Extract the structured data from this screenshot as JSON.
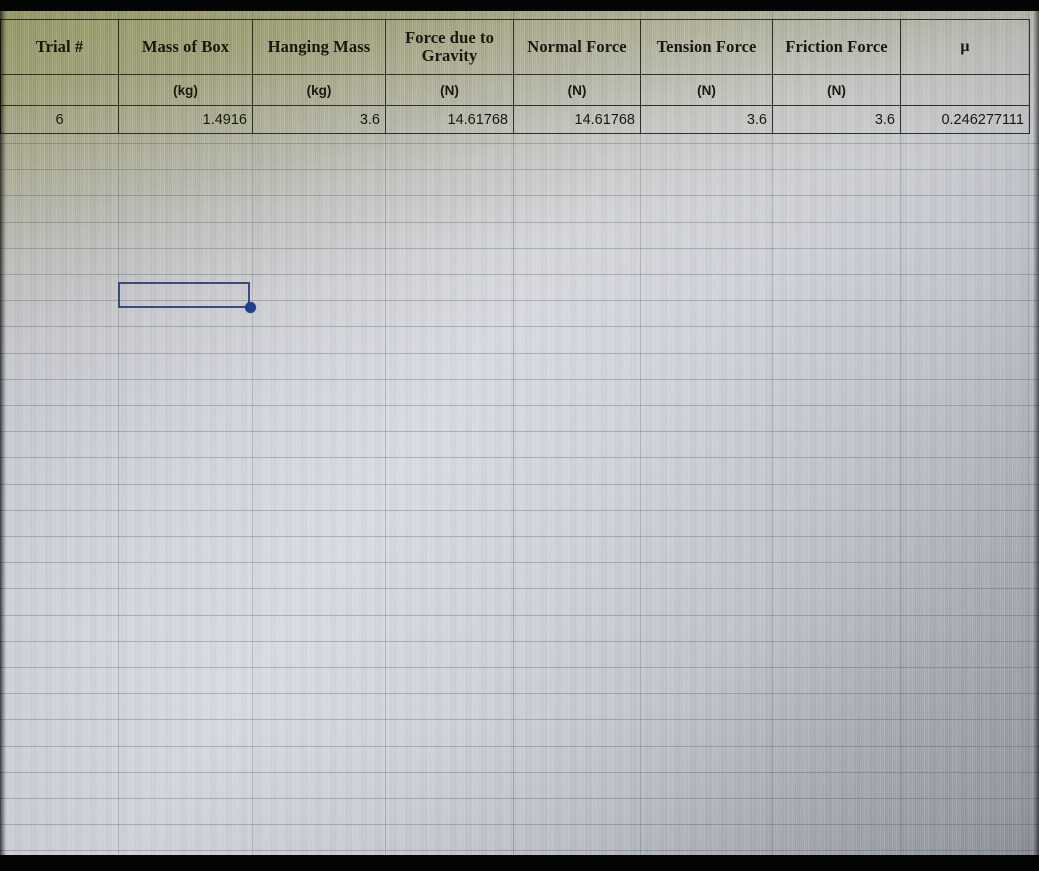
{
  "app": {
    "type": "spreadsheet",
    "capture": "photo-of-screen"
  },
  "colors": {
    "selection_border": "#3c4a7d",
    "fill_handle": "#1f3f8f",
    "table_border": "#2d3026",
    "text": "#17180f",
    "screen_tint_top": "#96986 2",
    "screen_body": "#d2d5dc"
  },
  "table": {
    "headers": [
      "Trial #",
      "Mass of Box",
      "Hanging Mass",
      "Force due to Gravity",
      "Normal Force",
      "Tension Force",
      "Friction Force",
      "μ"
    ],
    "units": [
      "",
      "(kg)",
      "(kg)",
      "(N)",
      "(N)",
      "(N)",
      "(N)",
      ""
    ],
    "rows": [
      {
        "trial": "6",
        "mass_of_box": "1.4916",
        "hanging_mass": "3.6",
        "force_due_to_gravity": "14.61768",
        "normal_force": "14.61768",
        "tension_force": "3.6",
        "friction_force": "3.6",
        "mu": "0.246277111"
      }
    ]
  },
  "selection": {
    "value": "",
    "placeholder": ""
  }
}
